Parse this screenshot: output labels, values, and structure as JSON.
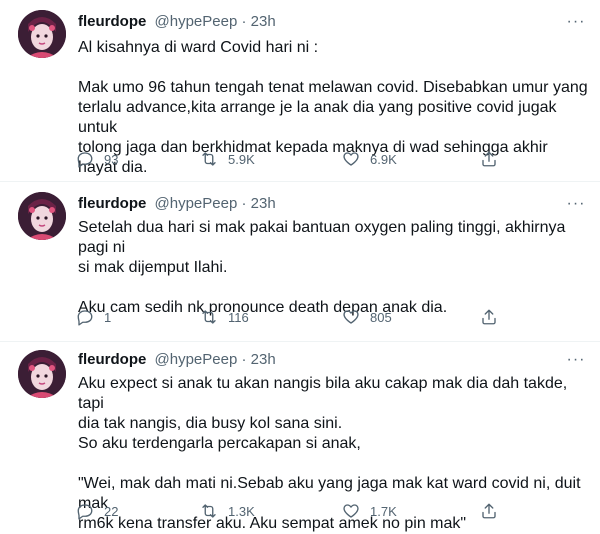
{
  "tweets": [
    {
      "name": "fleurdope",
      "handle": "@hypePeep",
      "dot": "·",
      "time": "23h",
      "lines": [
        "Al kisahnya di ward Covid hari ni :",
        "",
        "Mak umo 96 tahun tengah tenat melawan covid. Disebabkan umur yang",
        "terlalu advance,kita arrange je la anak dia yang positive covid jugak untuk",
        "tolong jaga dan berkhidmat kepada maknya di wad sehingga akhir hayat dia."
      ],
      "replies": "93",
      "retweets": "5.9K",
      "likes": "6.9K"
    },
    {
      "name": "fleurdope",
      "handle": "@hypePeep",
      "dot": "·",
      "time": "23h",
      "lines": [
        "Setelah dua hari si mak pakai bantuan oxygen paling tinggi, akhirnya pagi ni",
        "si mak dijemput Ilahi.",
        "",
        "Aku cam sedih nk pronounce death depan anak dia."
      ],
      "replies": "1",
      "retweets": "116",
      "likes": "805"
    },
    {
      "name": "fleurdope",
      "handle": "@hypePeep",
      "dot": "·",
      "time": "23h",
      "lines": [
        "Aku expect si anak tu akan nangis bila aku cakap mak dia dah takde, tapi",
        "dia tak nangis, dia busy kol sana sini.",
        "So aku terdengarla percakapan si anak,",
        "",
        "\"Wei, mak dah mati ni.Sebab aku yang jaga mak kat ward covid ni, duit mak",
        "rm6k kena transfer aku. Aku sempat amek no pin mak\""
      ],
      "replies": "22",
      "retweets": "1.3K",
      "likes": "1.7K"
    }
  ],
  "icons": {
    "more": "more-dots-icon",
    "reply": "reply-icon",
    "retweet": "retweet-icon",
    "like": "heart-icon",
    "share": "share-icon"
  },
  "colors": {
    "text": "#0f1419",
    "muted": "#536471",
    "divider": "#eff3f4"
  }
}
